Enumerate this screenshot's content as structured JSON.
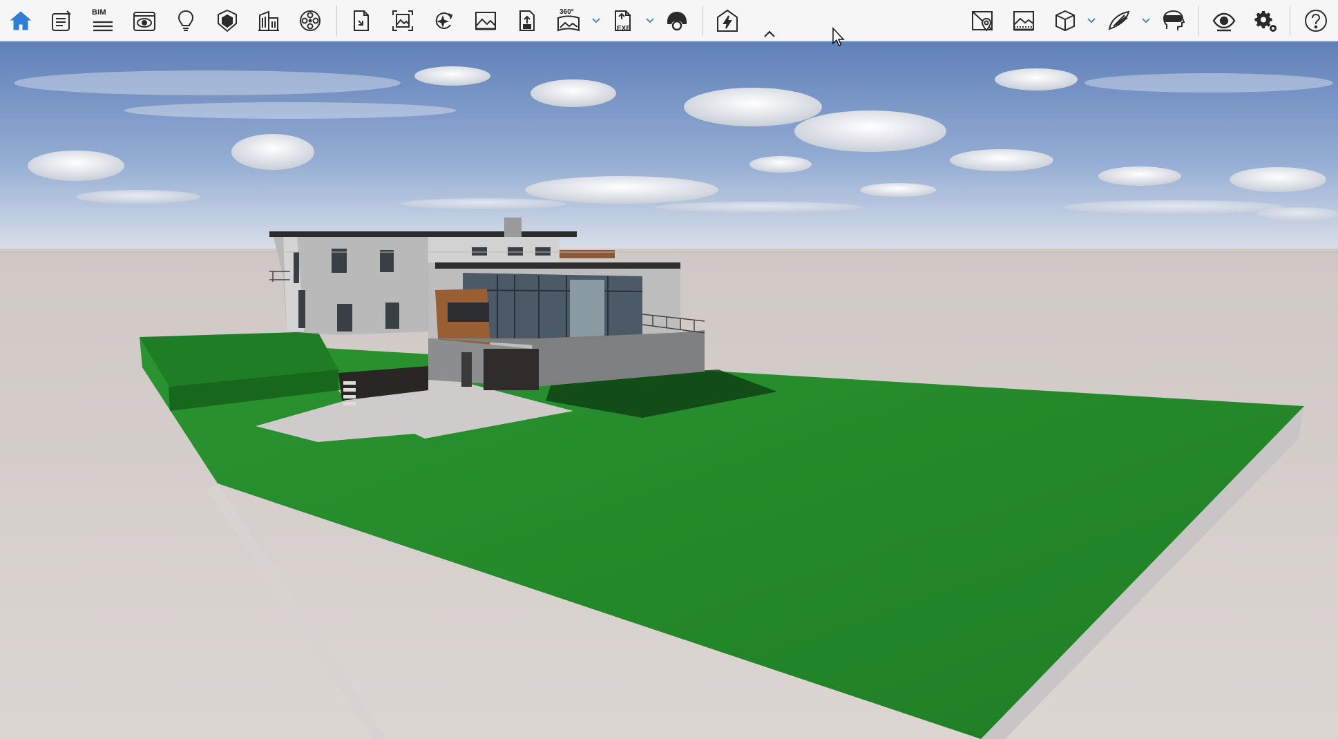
{
  "toolbar": {
    "left_tools": [
      {
        "id": "home",
        "icon": "home-icon",
        "active": true
      },
      {
        "id": "notes",
        "icon": "notes-edit-icon"
      },
      {
        "id": "bim",
        "icon": "bim-icon",
        "label": "BIM"
      },
      {
        "id": "view",
        "icon": "eye-window-icon"
      },
      {
        "id": "light",
        "icon": "lightbulb-icon"
      },
      {
        "id": "materials",
        "icon": "material-shield-icon"
      },
      {
        "id": "buildings",
        "icon": "building-icon"
      },
      {
        "id": "film",
        "icon": "film-reel-icon"
      }
    ],
    "export_tools": [
      {
        "id": "export-file",
        "icon": "export-file-icon"
      },
      {
        "id": "render-image",
        "icon": "render-image-icon"
      },
      {
        "id": "render-sparkle",
        "icon": "ai-sparkle-icon"
      },
      {
        "id": "image",
        "icon": "image-icon"
      },
      {
        "id": "export-package",
        "icon": "export-package-icon"
      },
      {
        "id": "panorama",
        "icon": "panorama-360-icon",
        "label": "360°",
        "dropdown": true
      },
      {
        "id": "exe",
        "icon": "exe-file-icon",
        "label": "EXE",
        "dropdown": true
      },
      {
        "id": "vr",
        "icon": "vr-headset-icon"
      }
    ],
    "live_tool": {
      "id": "live-sync",
      "icon": "lightning-house-icon"
    },
    "right_tools": [
      {
        "id": "site",
        "icon": "map-pin-icon"
      },
      {
        "id": "skybox",
        "icon": "skybox-image-icon"
      },
      {
        "id": "cube",
        "icon": "cube-icon",
        "dropdown": true
      },
      {
        "id": "wing",
        "icon": "wing-icon",
        "dropdown": true
      },
      {
        "id": "vr-view",
        "icon": "vr-head-icon"
      },
      {
        "id": "visibility",
        "icon": "eye-icon"
      },
      {
        "id": "settings",
        "icon": "gear-icon"
      },
      {
        "id": "help",
        "icon": "help-circle-icon"
      }
    ]
  },
  "colors": {
    "accent": "#2f7fd8",
    "icon": "#2a2a2a",
    "sky_top": "#5f80b8",
    "sky_bottom": "#d9dee6",
    "ground": "#d8d2cf",
    "lawn": "#258a2a"
  }
}
